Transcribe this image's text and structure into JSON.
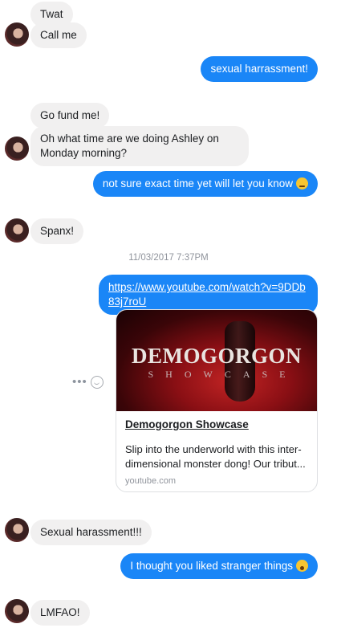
{
  "messages": {
    "m1": "Twat",
    "m2": "Call me",
    "m3": "sexual harrassment!",
    "m4": "Go fund me!",
    "m5": "Oh what time are we doing Ashley on Monday morning?",
    "m6": "not sure exact time yet will let you know",
    "m7": "Spanx!",
    "m8": "Sexual harassment!!!",
    "m9": "I thought you liked stranger things",
    "m10": "LMFAO!"
  },
  "timestamp": "11/03/2017 7:37PM",
  "link_message": {
    "url": "https://www.youtube.com/watch?v=9DDb83j7roU",
    "card": {
      "thumbnail_title": "DEMOGORGON",
      "thumbnail_subtitle": "SHOWCASE",
      "title": "Demogorgon Showcase",
      "description": "Slip into the underworld with this inter-dimensional monster dong! Our tribut...",
      "domain": "youtube.com"
    }
  },
  "colors": {
    "outgoing": "#1a86f7",
    "incoming": "#f1f0f0"
  }
}
